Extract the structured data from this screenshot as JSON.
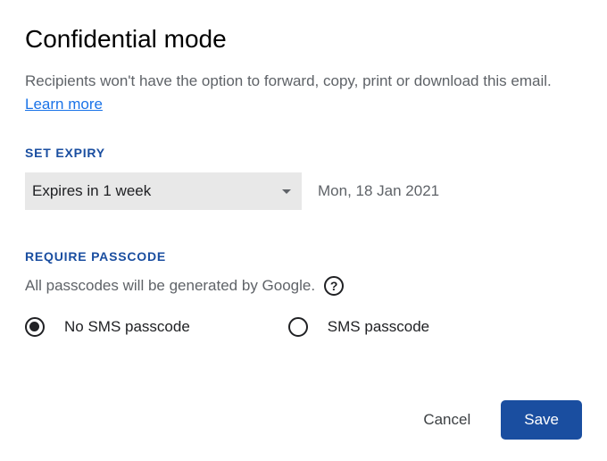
{
  "title": "Confidential mode",
  "description": "Recipients won't have the option to forward, copy, print or download this email. ",
  "learn_more": "Learn more",
  "expiry": {
    "label": "SET EXPIRY",
    "selected": "Expires in 1 week",
    "date": "Mon, 18 Jan 2021"
  },
  "passcode": {
    "label": "REQUIRE PASSCODE",
    "note": "All passcodes will be generated by Google.",
    "help_glyph": "?",
    "options": {
      "no_sms": "No SMS passcode",
      "sms": "SMS passcode"
    },
    "selected": "no_sms"
  },
  "buttons": {
    "cancel": "Cancel",
    "save": "Save"
  }
}
